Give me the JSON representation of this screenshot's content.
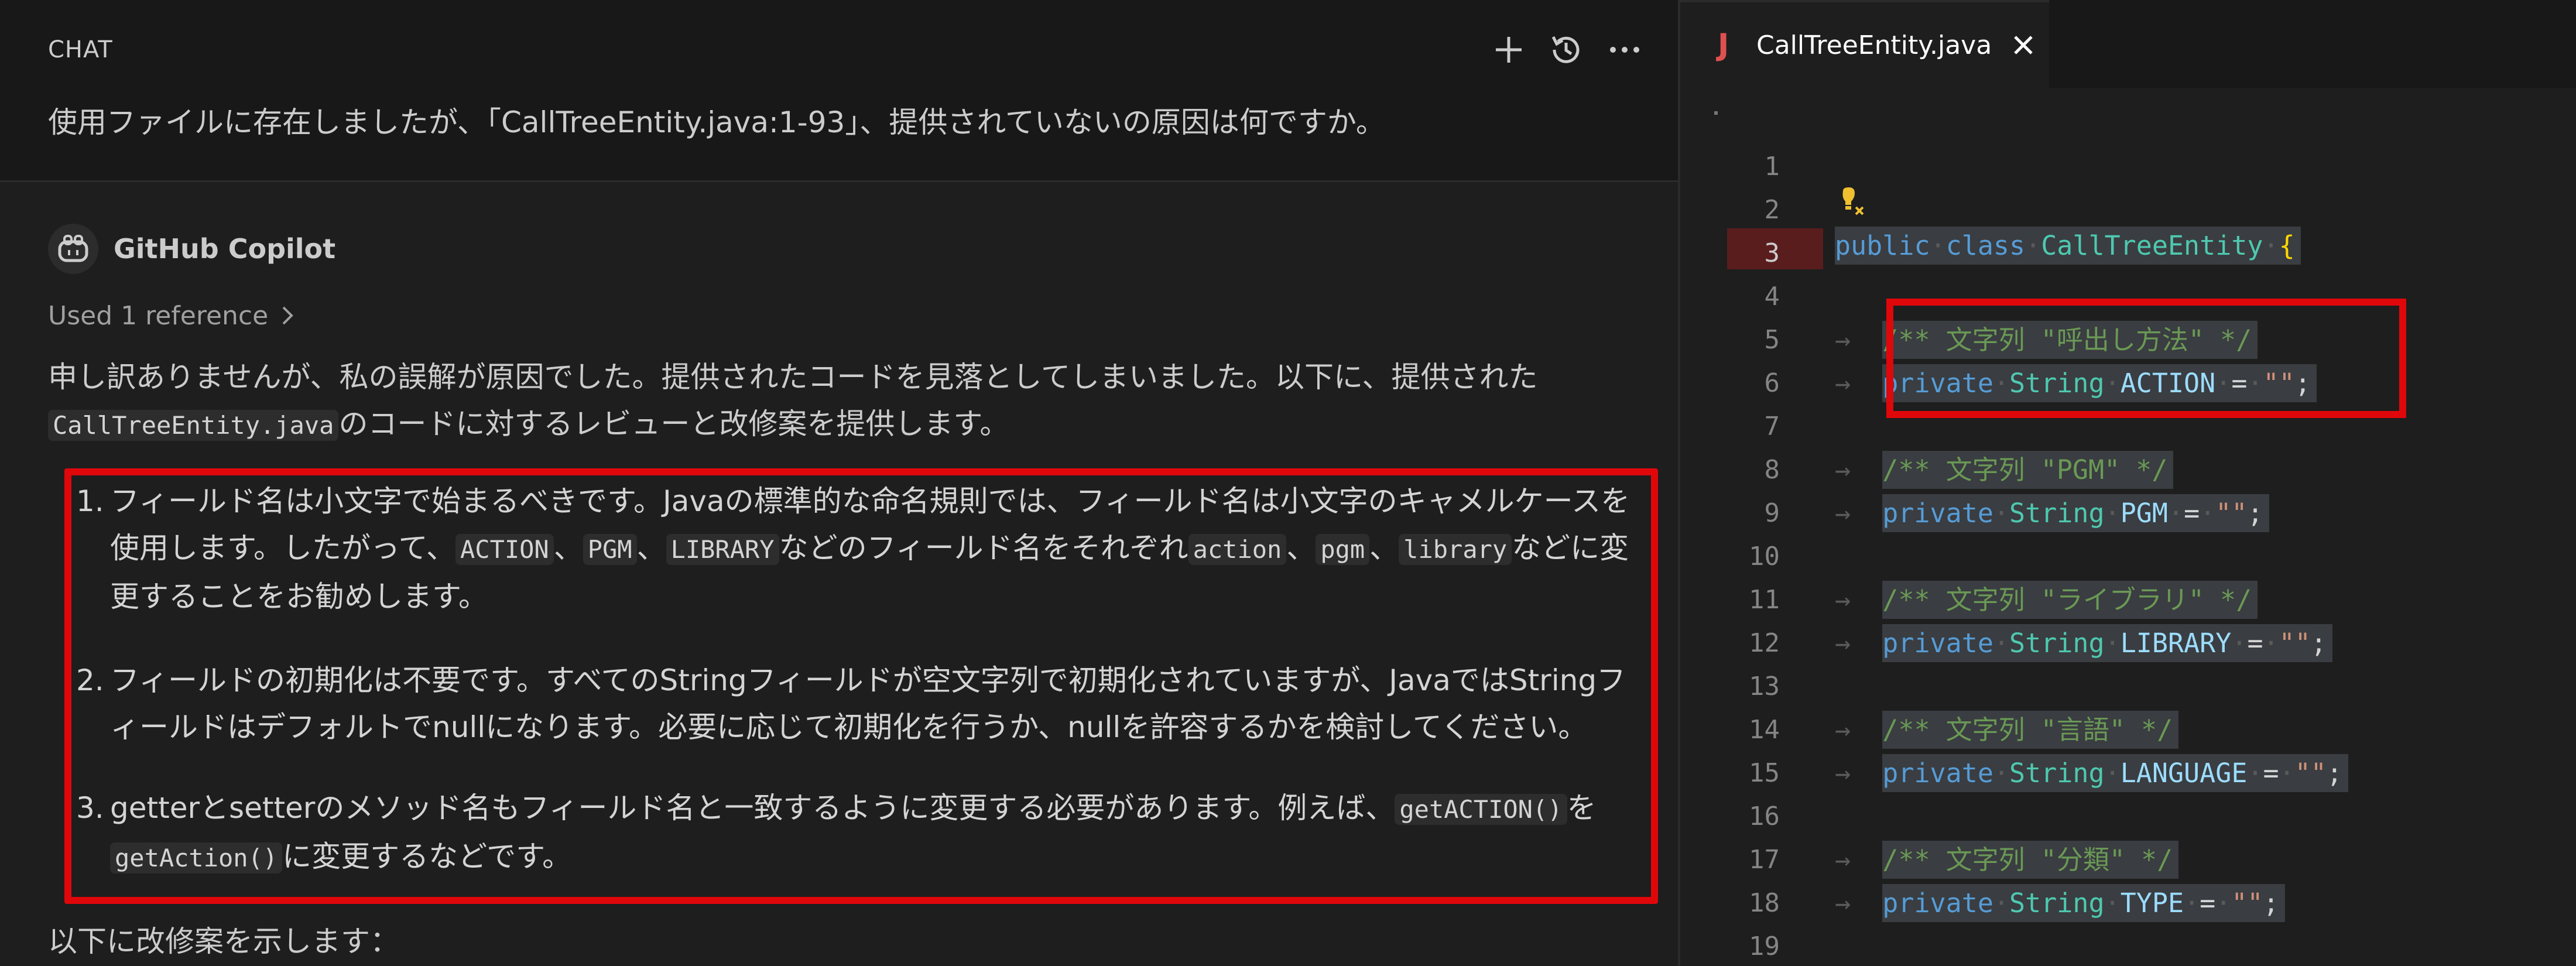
{
  "chat": {
    "title": "CHAT",
    "user_message": "使用ファイルに存在しましたが、「CallTreeEntity.java:1-93」、提供されていないの原因は何ですか。",
    "responder": "GitHub Copilot",
    "used_reference": "Used 1 reference",
    "intro_part1": "申し訳ありませんが、私の誤解が原因でした。提供されたコードを見落としてしまいました。以下に、提供された",
    "intro_code": "CallTreeEntity.java",
    "intro_part2": "のコードに対するレビューと改修案を提供します。",
    "items": [
      {
        "num": "1.",
        "t1": "フィールド名は小文字で始まるべきです。Javaの標準的な命名規則では、フィールド名は小文字のキャメルケースを使用します。したがって、",
        "c1": "ACTION",
        "t2": "、",
        "c2": "PGM",
        "t3": "、",
        "c3": "LIBRARY",
        "t4": "などのフィールド名をそれぞれ",
        "c4": "action",
        "t5": "、",
        "c5": "pgm",
        "t6": "、",
        "c6": "library",
        "t7": "などに変更することをお勧めします。"
      },
      {
        "num": "2.",
        "t1": "フィールドの初期化は不要です。すべてのStringフィールドが空文字列で初期化されていますが、JavaではStringフィールドはデフォルトでnullになります。必要に応じて初期化を行うか、nullを許容するかを検討してください。"
      },
      {
        "num": "3.",
        "t1": "getterとsetterのメソッド名もフィールド名と一致するように変更する必要があります。例えば、",
        "c1": "getACTION()",
        "t2": "を",
        "c2": "getAction()",
        "t3": "に変更するなどです。"
      }
    ],
    "footer": "以下に改修案を示します："
  },
  "editor": {
    "tab_title": "CallTreeEntity.java",
    "tab_icon": "J",
    "line_numbers": [
      "1",
      "2",
      "3",
      "4",
      "5",
      "6",
      "7",
      "8",
      "9",
      "10",
      "11",
      "12",
      "13",
      "14",
      "15",
      "16",
      "17",
      "18",
      "19"
    ],
    "class_kw1": "public",
    "class_kw2": "class",
    "class_name": "CallTreeEntity",
    "open_brace": "{",
    "fields": [
      {
        "comment": "/** 文字列 \"呼出し方法\" */",
        "kw": "private",
        "type": "String",
        "name": "ACTION",
        "eq": "=",
        "value": "\"\"",
        "semi": ";"
      },
      {
        "comment": "/** 文字列 \"PGM\" */",
        "kw": "private",
        "type": "String",
        "name": "PGM",
        "eq": "=",
        "value": "\"\"",
        "semi": ";"
      },
      {
        "comment": "/** 文字列 \"ライブラリ\" */",
        "kw": "private",
        "type": "String",
        "name": "LIBRARY",
        "eq": "=",
        "value": "\"\"",
        "semi": ";"
      },
      {
        "comment": "/** 文字列 \"言語\" */",
        "kw": "private",
        "type": "String",
        "name": "LANGUAGE",
        "eq": "=",
        "value": "\"\"",
        "semi": ";"
      },
      {
        "comment": "/** 文字列 \"分類\" */",
        "kw": "private",
        "type": "String",
        "name": "TYPE",
        "eq": "=",
        "value": "\"\"",
        "semi": ";"
      }
    ]
  },
  "colors": {
    "highlight_box": "#e0070b",
    "keyword": "#569cd6",
    "type": "#4ec9b0",
    "comment": "#6a9955"
  }
}
